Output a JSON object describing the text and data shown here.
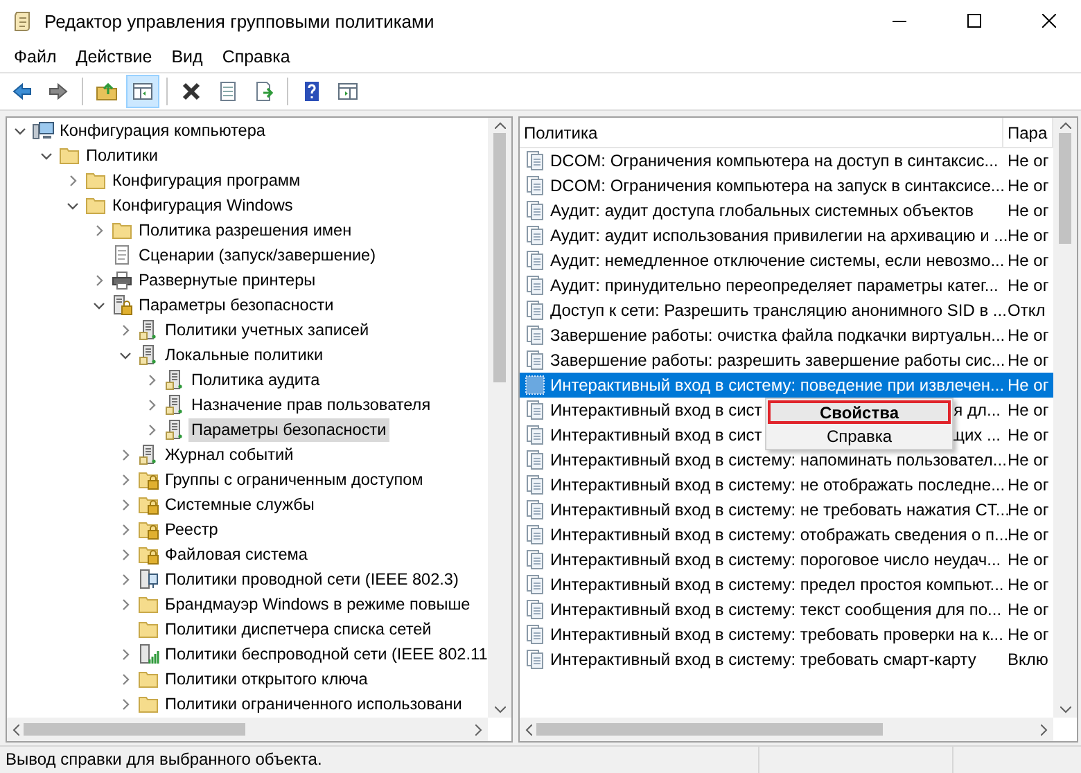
{
  "window": {
    "title": "Редактор управления групповыми политиками"
  },
  "menu": [
    "Файл",
    "Действие",
    "Вид",
    "Справка"
  ],
  "toolbar": [
    {
      "kind": "back"
    },
    {
      "kind": "forward"
    },
    {
      "kind": "sep"
    },
    {
      "kind": "up"
    },
    {
      "kind": "tree",
      "selected": true
    },
    {
      "kind": "sep"
    },
    {
      "kind": "delete"
    },
    {
      "kind": "properties"
    },
    {
      "kind": "export"
    },
    {
      "kind": "sep"
    },
    {
      "kind": "help"
    },
    {
      "kind": "panel"
    }
  ],
  "tree": [
    {
      "label": "Конфигурация компьютера",
      "kind": "computer",
      "expanded": true,
      "selected": false,
      "children": [
        {
          "label": "Политики",
          "kind": "folder",
          "expanded": true,
          "selected": false,
          "children": [
            {
              "label": "Конфигурация программ",
              "kind": "folder",
              "expanded": false,
              "selected": false
            },
            {
              "label": "Конфигурация Windows",
              "kind": "folder",
              "expanded": true,
              "selected": false,
              "children": [
                {
                  "label": "Политика разрешения имен",
                  "kind": "folder",
                  "expanded": false,
                  "selected": false
                },
                {
                  "label": "Сценарии (запуск/завершение)",
                  "kind": "script",
                  "selected": false
                },
                {
                  "label": "Развернутые принтеры",
                  "kind": "printer",
                  "expanded": false,
                  "selected": false
                },
                {
                  "label": "Параметры безопасности",
                  "kind": "secure",
                  "expanded": true,
                  "selected": false,
                  "children": [
                    {
                      "label": "Политики учетных записей",
                      "kind": "server",
                      "expanded": false,
                      "selected": false
                    },
                    {
                      "label": "Локальные политики",
                      "kind": "server",
                      "expanded": true,
                      "selected": false,
                      "children": [
                        {
                          "label": "Политика аудита",
                          "kind": "server",
                          "expanded": false,
                          "selected": false
                        },
                        {
                          "label": "Назначение прав пользователя",
                          "kind": "server",
                          "expanded": false,
                          "selected": false
                        },
                        {
                          "label": "Параметры безопасности",
                          "kind": "server",
                          "expanded": false,
                          "selected": true
                        }
                      ]
                    },
                    {
                      "label": "Журнал событий",
                      "kind": "server",
                      "expanded": false,
                      "selected": false
                    },
                    {
                      "label": "Группы с ограниченным доступом",
                      "kind": "lockfolder",
                      "expanded": false,
                      "selected": false
                    },
                    {
                      "label": "Системные службы",
                      "kind": "lockfolder",
                      "expanded": false,
                      "selected": false
                    },
                    {
                      "label": "Реестр",
                      "kind": "lockfolder",
                      "expanded": false,
                      "selected": false
                    },
                    {
                      "label": "Файловая система",
                      "kind": "lockfolder",
                      "expanded": false,
                      "selected": false
                    },
                    {
                      "label": "Политики проводной сети (IEEE 802.3)",
                      "kind": "wired",
                      "expanded": false,
                      "selected": false
                    },
                    {
                      "label": "Брандмауэр Windows в режиме повыше",
                      "kind": "folder",
                      "expanded": false,
                      "selected": false
                    },
                    {
                      "label": "Политики диспетчера списка сетей",
                      "kind": "folder",
                      "selected": false
                    },
                    {
                      "label": "Политики беспроводной сети (IEEE 802.11",
                      "kind": "wireless",
                      "expanded": false,
                      "selected": false
                    },
                    {
                      "label": "Политики открытого ключа",
                      "kind": "folder",
                      "expanded": false,
                      "selected": false
                    },
                    {
                      "label": "Политики ограниченного использовани",
                      "kind": "folder",
                      "expanded": false,
                      "selected": false
                    }
                  ]
                }
              ]
            }
          ]
        }
      ]
    }
  ],
  "list": {
    "columns": [
      "Политика",
      "Пара"
    ],
    "rows": [
      {
        "policy": "DCOM: Ограничения компьютера на доступ в синтаксис...",
        "setting": "Не ог",
        "selected": false
      },
      {
        "policy": "DCOM: Ограничения компьютера на запуск в синтаксисе...",
        "setting": "Не ог",
        "selected": false
      },
      {
        "policy": "Аудит: аудит доступа глобальных системных объектов",
        "setting": "Не ог",
        "selected": false
      },
      {
        "policy": "Аудит: аудит использования привилегии на архивацию и ...",
        "setting": "Не ог",
        "selected": false
      },
      {
        "policy": "Аудит: немедленное отключение системы, если невозмо...",
        "setting": "Не ог",
        "selected": false
      },
      {
        "policy": "Аудит: принудительно переопределяет параметры катег...",
        "setting": "Не ог",
        "selected": false
      },
      {
        "policy": "Доступ к сети: Разрешить трансляцию анонимного SID в ...",
        "setting": "Откл",
        "selected": false
      },
      {
        "policy": "Завершение работы: очистка файла подкачки виртуальн...",
        "setting": "Не ог",
        "selected": false
      },
      {
        "policy": "Завершение работы: разрешить завершение работы сис...",
        "setting": "Не ог",
        "selected": false
      },
      {
        "policy": "Интерактивный вход в систему: поведение при извлечен...",
        "setting": "Не ог",
        "selected": true
      },
      {
        "policy": "Интерактивный вход в сист",
        "policy_end": "я дл...",
        "setting": "Не ог",
        "selected": false
      },
      {
        "policy": "Интерактивный вход в сист",
        "policy_end": "щих ...",
        "setting": "Не ог",
        "selected": false
      },
      {
        "policy": "Интерактивный вход в систему: напоминать пользовател...",
        "setting": "Не ог",
        "selected": false
      },
      {
        "policy": "Интерактивный вход в систему: не отображать последне...",
        "setting": "Не ог",
        "selected": false
      },
      {
        "policy": "Интерактивный вход в систему: не требовать нажатия CT...",
        "setting": "Не ог",
        "selected": false
      },
      {
        "policy": "Интерактивный вход в систему: отображать сведения о п...",
        "setting": "Не ог",
        "selected": false
      },
      {
        "policy": "Интерактивный вход в систему: пороговое число неудач...",
        "setting": "Не ог",
        "selected": false
      },
      {
        "policy": "Интерактивный вход в систему: предел простоя компьют...",
        "setting": "Не ог",
        "selected": false
      },
      {
        "policy": "Интерактивный вход в систему: текст сообщения для по...",
        "setting": "Не ог",
        "selected": false
      },
      {
        "policy": "Интерактивный вход в систему: требовать проверки на к...",
        "setting": "Не ог",
        "selected": false
      },
      {
        "policy": "Интерактивный вход в систему: требовать смарт-карту",
        "setting": "Вклю",
        "selected": false
      }
    ]
  },
  "context_menu": [
    {
      "label": "Свойства",
      "selected": true
    },
    {
      "label": "Справка",
      "selected": false
    }
  ],
  "status_bar": "Вывод справки для выбранного объекта."
}
